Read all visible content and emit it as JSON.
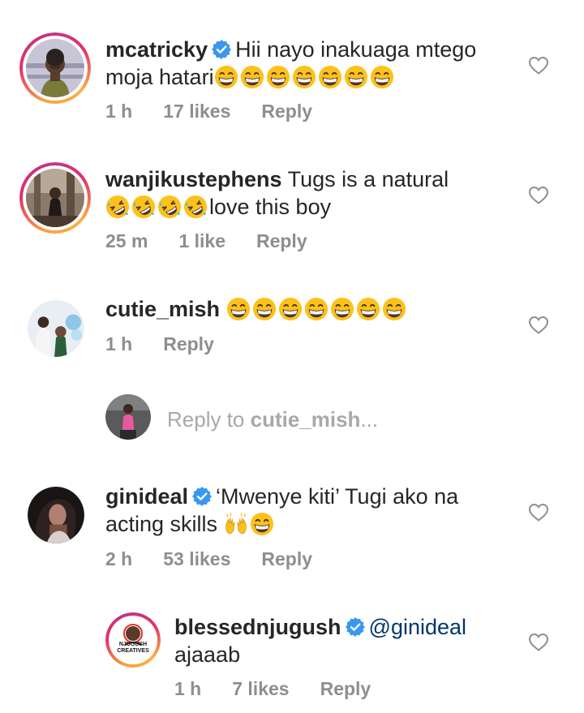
{
  "colors": {
    "verified": "#3897f0",
    "meta": "#8e8e8e",
    "mention": "#00376b",
    "heart": "#8e8e8e"
  },
  "comments": [
    {
      "username": "mcatricky",
      "verified": true,
      "text": "Hii nayo inakuaga mtego moja hatari",
      "emoji_count": 7,
      "emoji": "grinning-face-with-closed-eyes",
      "time": "1 h",
      "likes": "17 likes",
      "reply": "Reply"
    },
    {
      "username": "wanjikustephens",
      "verified": false,
      "text": "Tugs is a natural",
      "text2": "love this boy",
      "emoji_count": 4,
      "emoji": "rolling-on-floor-laughing",
      "time": "25 m",
      "likes": "1 like",
      "reply": "Reply"
    },
    {
      "username": "cutie_mish",
      "verified": false,
      "emoji_count": 7,
      "emoji": "grinning-face-with-closed-eyes",
      "time": "1 h",
      "reply": "Reply"
    },
    {
      "username": "ginideal",
      "verified": true,
      "text": "‘Mwenye kiti’ Tugi ako na acting skills",
      "emoji": "raising-hands, grinning-face-with-closed-eyes",
      "time": "2 h",
      "likes": "53 likes",
      "reply": "Reply"
    },
    {
      "username": "blessednjugush",
      "verified": true,
      "mention": "@ginideal",
      "text": "ajaaab",
      "avatar_text": "NJUGUSH CREATIVES",
      "time": "1 h",
      "likes": "7 likes",
      "reply": "Reply"
    }
  ],
  "reply_input": {
    "prefix": "Reply to ",
    "target": "cutie_mish",
    "suffix": "..."
  }
}
